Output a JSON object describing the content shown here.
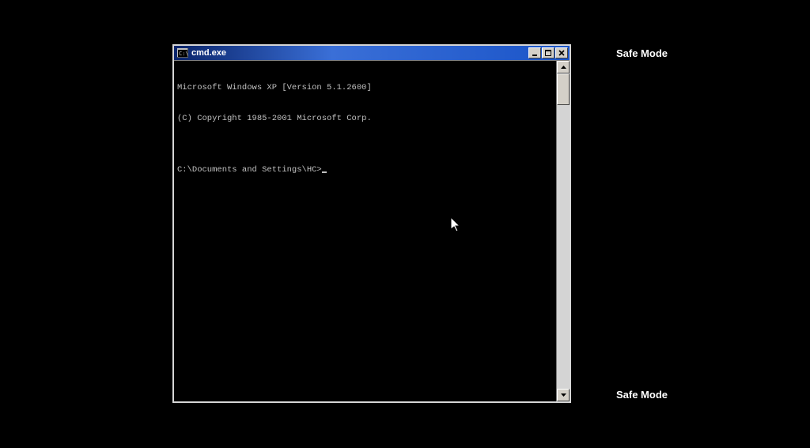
{
  "safe_mode_label": "Safe Mode",
  "window": {
    "title": "cmd.exe",
    "console_lines": [
      "Microsoft Windows XP [Version 5.1.2600]",
      "(C) Copyright 1985-2001 Microsoft Corp.",
      ""
    ],
    "prompt": "C:\\Documents and Settings\\HC>"
  }
}
